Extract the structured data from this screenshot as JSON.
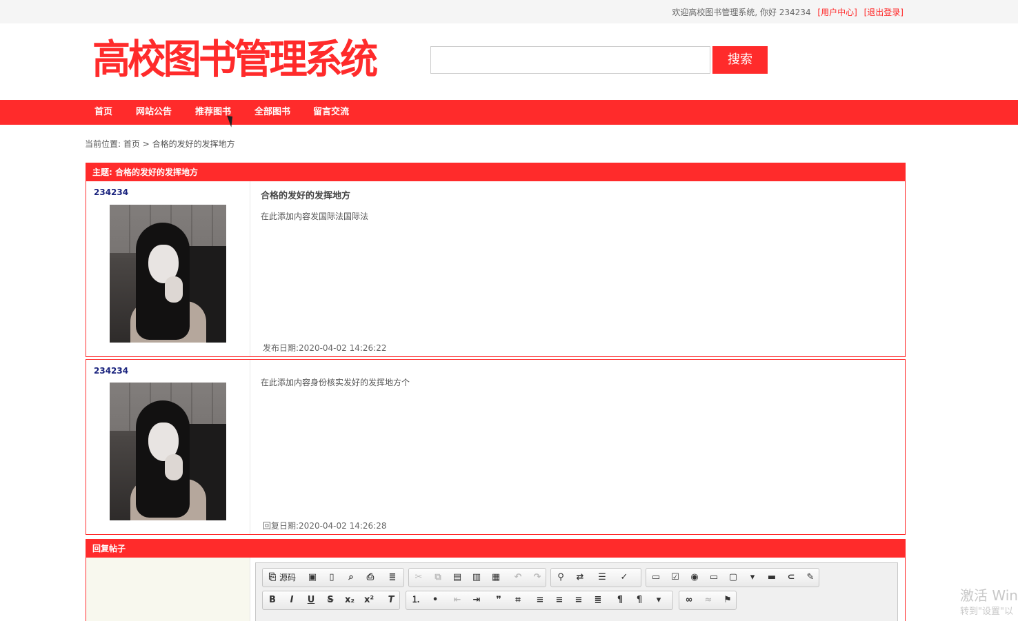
{
  "topbar": {
    "welcome": "欢迎高校图书管理系统, 你好 234234",
    "user_center": "[用户中心]",
    "logout": "[退出登录]"
  },
  "header": {
    "logo": "高校图书管理系统",
    "search_placeholder": "",
    "search_button": "搜索"
  },
  "nav": {
    "items": [
      "首页",
      "网站公告",
      "推荐图书",
      "全部图书",
      "留言交流"
    ]
  },
  "breadcrumb": {
    "prefix": "当前位置:",
    "home": "首页",
    "separator": ">",
    "current": "合格的发好的发挥地方"
  },
  "thread": {
    "topic_label": "主题: 合格的发好的发挥地方",
    "posts": [
      {
        "username": "234234",
        "title": "合格的发好的发挥地方",
        "content": "在此添加内容发国际法国际法",
        "date": "发布日期:2020-04-02 14:26:22"
      },
      {
        "username": "234234",
        "title": "",
        "content": "在此添加内容身份核实发好的发挥地方个",
        "date": "回复日期:2020-04-02 14:26:28"
      }
    ]
  },
  "reply": {
    "header": "回复帖子",
    "source_button": "源码"
  },
  "watermark": {
    "line1": "激活 Win",
    "line2": "转到\"设置\"以"
  }
}
